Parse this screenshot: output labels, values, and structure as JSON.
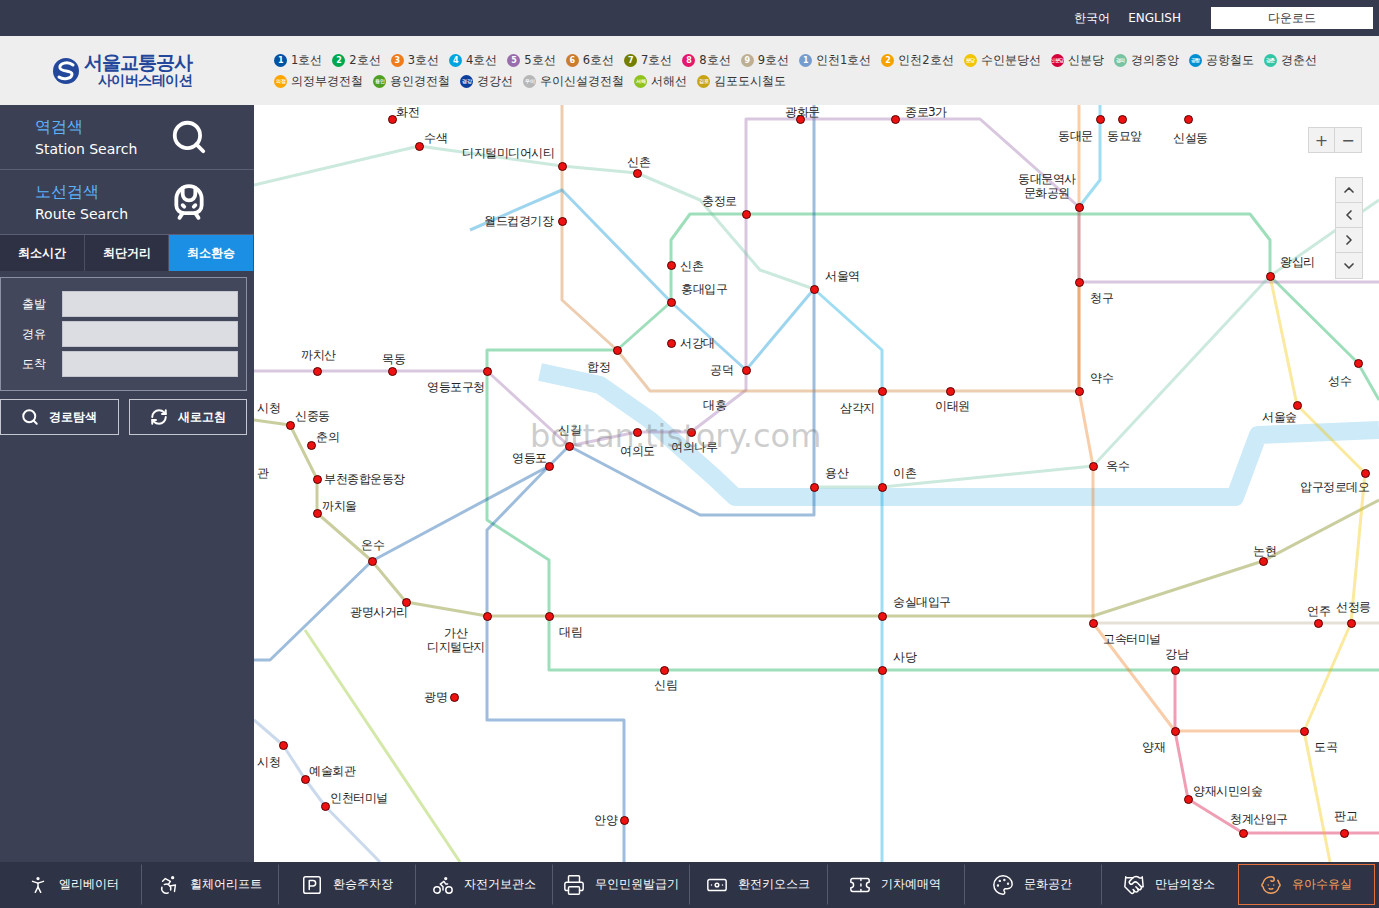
{
  "topbar": {
    "languages": [
      "한국어",
      "ENGLISH"
    ],
    "download": "다운로드"
  },
  "logo": {
    "title": "서울교통공사",
    "subtitle": "사이버스테이션"
  },
  "legend": [
    {
      "badge": "1",
      "label": "1호선",
      "color": "#0052a4"
    },
    {
      "badge": "2",
      "label": "2호선",
      "color": "#00a84d"
    },
    {
      "badge": "3",
      "label": "3호선",
      "color": "#ef7c1c"
    },
    {
      "badge": "4",
      "label": "4호선",
      "color": "#00a5de"
    },
    {
      "badge": "5",
      "label": "5호선",
      "color": "#996cac"
    },
    {
      "badge": "6",
      "label": "6호선",
      "color": "#cd7c2f"
    },
    {
      "badge": "7",
      "label": "7호선",
      "color": "#747f00"
    },
    {
      "badge": "8",
      "label": "8호선",
      "color": "#e6186c"
    },
    {
      "badge": "9",
      "label": "9호선",
      "color": "#bdb092"
    },
    {
      "badge": "1",
      "label": "인천1호선",
      "color": "#759cce"
    },
    {
      "badge": "2",
      "label": "인천2호선",
      "color": "#f5a200"
    },
    {
      "badge": "분당",
      "label": "수인분당선",
      "color": "#f2c500"
    },
    {
      "badge": "신분당",
      "label": "신분당",
      "color": "#d4003b"
    },
    {
      "badge": "경의",
      "label": "경의중앙",
      "color": "#77c4a3"
    },
    {
      "badge": "공항",
      "label": "공항철도",
      "color": "#0090d2"
    },
    {
      "badge": "경춘",
      "label": "경춘선",
      "color": "#32c6a6"
    },
    {
      "badge": "의정",
      "label": "의정부경전철",
      "color": "#fda600"
    },
    {
      "badge": "용인",
      "label": "용인경전철",
      "color": "#509f22"
    },
    {
      "badge": "경강",
      "label": "경강선",
      "color": "#0c3e9c"
    },
    {
      "badge": "우이",
      "label": "우이신설경전철",
      "color": "#b7b7b7"
    },
    {
      "badge": "서해",
      "label": "서해선",
      "color": "#8fc31f"
    },
    {
      "badge": "김포",
      "label": "김포도시철도",
      "color": "#c8a415"
    }
  ],
  "sidebar": {
    "modes": [
      {
        "title": "역검색",
        "subtitle": "Station Search"
      },
      {
        "title": "노선검색",
        "subtitle": "Route Search"
      }
    ],
    "tabs": [
      {
        "label": "최소시간",
        "selected": false
      },
      {
        "label": "최단거리",
        "selected": false
      },
      {
        "label": "최소환승",
        "selected": true
      }
    ],
    "fields": [
      {
        "label": "출발",
        "value": ""
      },
      {
        "label": "경유",
        "value": ""
      },
      {
        "label": "도착",
        "value": ""
      }
    ],
    "buttons": [
      "경로탐색",
      "새로고침"
    ]
  },
  "map": {
    "zoom": [
      "+",
      "−"
    ],
    "watermark": "bottan.tistory.com",
    "stations": [
      {
        "name": "화전",
        "dot": true
      },
      {
        "name": "수색",
        "dot": true
      },
      {
        "name": "디지털미디어시티",
        "dot": true
      },
      {
        "name": "신촌",
        "dot": true
      },
      {
        "name": "월드컵경기장",
        "dot": true
      },
      {
        "name": "충정로",
        "dot": true
      },
      {
        "name": "광화문",
        "dot": true
      },
      {
        "name": "종로3가",
        "dot": true
      },
      {
        "name": "동대문",
        "dot": true
      },
      {
        "name": "동묘앞",
        "dot": true
      },
      {
        "name": "신설동",
        "dot": true
      },
      {
        "name": "동대문역사\n문화공원",
        "dot": true
      },
      {
        "name": "신촌",
        "dot": true
      },
      {
        "name": "홍대입구",
        "dot": true
      },
      {
        "name": "서울역",
        "dot": true
      },
      {
        "name": "청구",
        "dot": true
      },
      {
        "name": "왕십리",
        "dot": true
      },
      {
        "name": "서강대",
        "dot": true
      },
      {
        "name": "합정",
        "dot": true
      },
      {
        "name": "공덕",
        "dot": true
      },
      {
        "name": "까치산",
        "dot": true
      },
      {
        "name": "목동",
        "dot": true
      },
      {
        "name": "영등포구청",
        "dot": true
      },
      {
        "name": "대흥",
        "dot": false
      },
      {
        "name": "삼각지",
        "dot": true
      },
      {
        "name": "이태원",
        "dot": true
      },
      {
        "name": "약수",
        "dot": true
      },
      {
        "name": "성수",
        "dot": true
      },
      {
        "name": "서울숲",
        "dot": true
      },
      {
        "name": "시청",
        "dot": false
      },
      {
        "name": "신중동",
        "dot": true
      },
      {
        "name": "춘의",
        "dot": true
      },
      {
        "name": "신길",
        "dot": true
      },
      {
        "name": "여의도",
        "dot": true
      },
      {
        "name": "여의나루",
        "dot": true
      },
      {
        "name": "영등포",
        "dot": true
      },
      {
        "name": "용산",
        "dot": true
      },
      {
        "name": "이촌",
        "dot": true
      },
      {
        "name": "옥수",
        "dot": true
      },
      {
        "name": "압구정로데오",
        "dot": true
      },
      {
        "name": "관",
        "dot": false
      },
      {
        "name": "부천종합운동장",
        "dot": true
      },
      {
        "name": "까치울",
        "dot": true
      },
      {
        "name": "온수",
        "dot": true
      },
      {
        "name": "논현",
        "dot": true
      },
      {
        "name": "광명사거리",
        "dot": true
      },
      {
        "name": "가산\n디지털단지",
        "dot": true
      },
      {
        "name": "대림",
        "dot": true
      },
      {
        "name": "숭실대입구",
        "dot": true
      },
      {
        "name": "고속터미널",
        "dot": true
      },
      {
        "name": "언주",
        "dot": true
      },
      {
        "name": "선정릉",
        "dot": true
      },
      {
        "name": "강남",
        "dot": true
      },
      {
        "name": "사당",
        "dot": true
      },
      {
        "name": "신림",
        "dot": true
      },
      {
        "name": "광명",
        "dot": true
      },
      {
        "name": "양재",
        "dot": true
      },
      {
        "name": "도곡",
        "dot": true
      },
      {
        "name": "시청",
        "dot": true
      },
      {
        "name": "예술회관",
        "dot": true
      },
      {
        "name": "인천터미널",
        "dot": true
      },
      {
        "name": "양재시민의숲",
        "dot": true
      },
      {
        "name": "청계산입구",
        "dot": true
      },
      {
        "name": "판교",
        "dot": true
      },
      {
        "name": "안양",
        "dot": true
      }
    ]
  },
  "facilities": [
    {
      "label": "엘리베이터",
      "selected": false
    },
    {
      "label": "휠체어리프트",
      "selected": false
    },
    {
      "label": "환승주차장",
      "selected": false
    },
    {
      "label": "자전거보관소",
      "selected": false
    },
    {
      "label": "무인민원발급기",
      "selected": false
    },
    {
      "label": "환전키오스크",
      "selected": false
    },
    {
      "label": "기차예매역",
      "selected": false
    },
    {
      "label": "문화공간",
      "selected": false
    },
    {
      "label": "만남의장소",
      "selected": false
    },
    {
      "label": "유아수유실",
      "selected": true
    }
  ]
}
